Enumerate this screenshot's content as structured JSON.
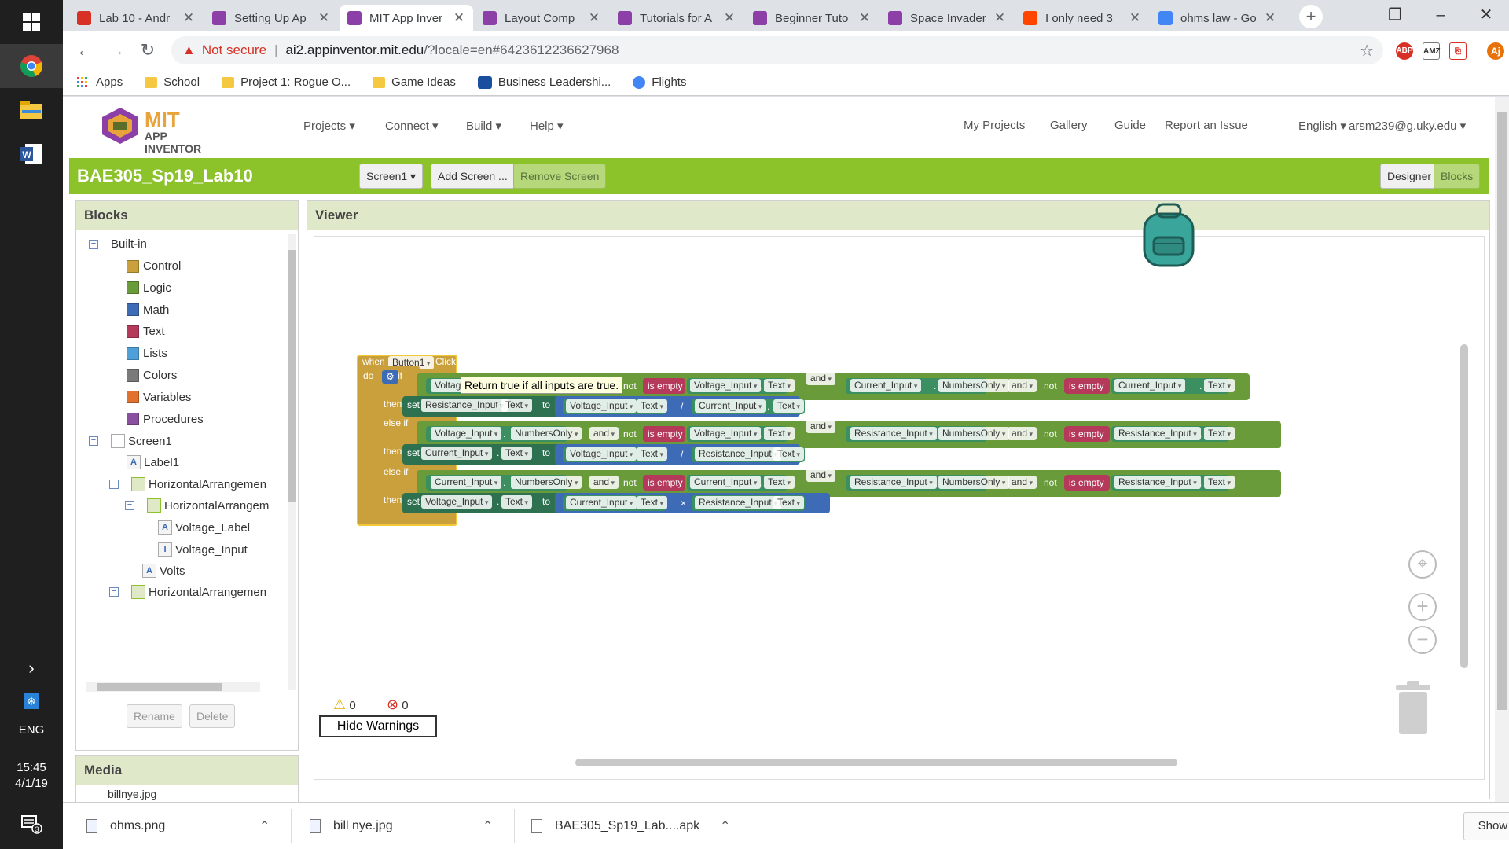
{
  "taskbar": {
    "language": "ENG",
    "time": "15:45",
    "date": "4/1/19",
    "notifications_count": "3"
  },
  "tabs": [
    {
      "label": "Lab 10 - Andr",
      "icon_color": "#d93025",
      "active": false
    },
    {
      "label": "Setting Up Ap",
      "icon_color": "#8c3fa6",
      "active": false
    },
    {
      "label": "MIT App Inver",
      "icon_color": "#8c3fa6",
      "active": true
    },
    {
      "label": "Layout Comp",
      "icon_color": "#8c3fa6",
      "active": false
    },
    {
      "label": "Tutorials for A",
      "icon_color": "#8c3fa6",
      "active": false
    },
    {
      "label": "Beginner Tuto",
      "icon_color": "#8c3fa6",
      "active": false
    },
    {
      "label": "Space Invader",
      "icon_color": "#8c3fa6",
      "active": false
    },
    {
      "label": "I only need 3",
      "icon_color": "#ff4500",
      "active": false
    },
    {
      "label": "ohms law - Go",
      "icon_color": "#4285f4",
      "active": false
    }
  ],
  "address": {
    "warning": "Not secure",
    "host": "ai2.appinventor.mit.edu",
    "path": "/?locale=en#6423612236627968"
  },
  "extensions": {
    "abp": "ABP",
    "amz": "AMZ",
    "user": "Aj"
  },
  "bookmarks": [
    {
      "label": "Apps",
      "type": "apps"
    },
    {
      "label": "School",
      "type": "folder"
    },
    {
      "label": "Project 1: Rogue O...",
      "type": "folder"
    },
    {
      "label": "Game Ideas",
      "type": "folder"
    },
    {
      "label": "Business Leadershi...",
      "type": "site"
    },
    {
      "label": "Flights",
      "type": "site"
    }
  ],
  "header": {
    "logo_mit": "MIT",
    "logo_app": "APP INVENTOR",
    "menu": [
      "Projects ▾",
      "Connect ▾",
      "Build ▾",
      "Help ▾"
    ],
    "right_links": [
      "My Projects",
      "Gallery",
      "Guide",
      "Report an Issue",
      "English ▾",
      "arsm239@g.uky.edu ▾"
    ]
  },
  "projectbar": {
    "name": "BAE305_Sp19_Lab10",
    "screen_select": "Screen1 ▾",
    "add_screen": "Add Screen ...",
    "remove_screen": "Remove Screen",
    "designer": "Designer",
    "blocks": "Blocks"
  },
  "blocks_panel": {
    "title": "Blocks",
    "builtin_label": "Built-in",
    "builtin": [
      {
        "label": "Control",
        "color": "#c9a03c"
      },
      {
        "label": "Logic",
        "color": "#6a9b3a"
      },
      {
        "label": "Math",
        "color": "#3e6bb5"
      },
      {
        "label": "Text",
        "color": "#b5395b"
      },
      {
        "label": "Lists",
        "color": "#4fa0d8"
      },
      {
        "label": "Colors",
        "color": "#7a7a7a"
      },
      {
        "label": "Variables",
        "color": "#e0712e"
      },
      {
        "label": "Procedures",
        "color": "#8a4f9e"
      }
    ],
    "components": [
      {
        "label": "Screen1"
      },
      {
        "label": "Label1"
      },
      {
        "label": "HorizontalArrangemen"
      },
      {
        "label": "HorizontalArrangem"
      },
      {
        "label": "Voltage_Label"
      },
      {
        "label": "Voltage_Input"
      },
      {
        "label": "Volts"
      },
      {
        "label": "HorizontalArrangemen"
      }
    ],
    "rename": "Rename",
    "delete": "Delete"
  },
  "media_panel": {
    "title": "Media",
    "first_item": "billnye.jpg"
  },
  "viewer": {
    "title": "Viewer",
    "warnings_count": "0",
    "errors_count": "0",
    "hide_warnings": "Hide Warnings",
    "tooltip": "Return true if all inputs are true."
  },
  "program": {
    "event": {
      "when": "when",
      "component": "Button1",
      "event": "Click",
      "do": "do"
    },
    "if_kw": "if",
    "then_kw": "then",
    "elseif_kw": "else if",
    "set_kw": "set",
    "to_kw": "to",
    "and_kw": "and",
    "not_kw": "not",
    "is_empty": "is empty",
    "text_prop": "Text",
    "numbers_only": "NumbersOnly",
    "voltage_input": "Voltage_Input",
    "current_input": "Current_Input",
    "resistance_input": "Resistance_Input",
    "voltage_input_clipped": "Voltag",
    "divide": "/",
    "multiply": "×",
    "dot": "."
  },
  "downloads": [
    {
      "label": "ohms.png"
    },
    {
      "label": "bill nye.jpg"
    },
    {
      "label": "BAE305_Sp19_Lab....apk"
    }
  ],
  "show_all": "Show all"
}
